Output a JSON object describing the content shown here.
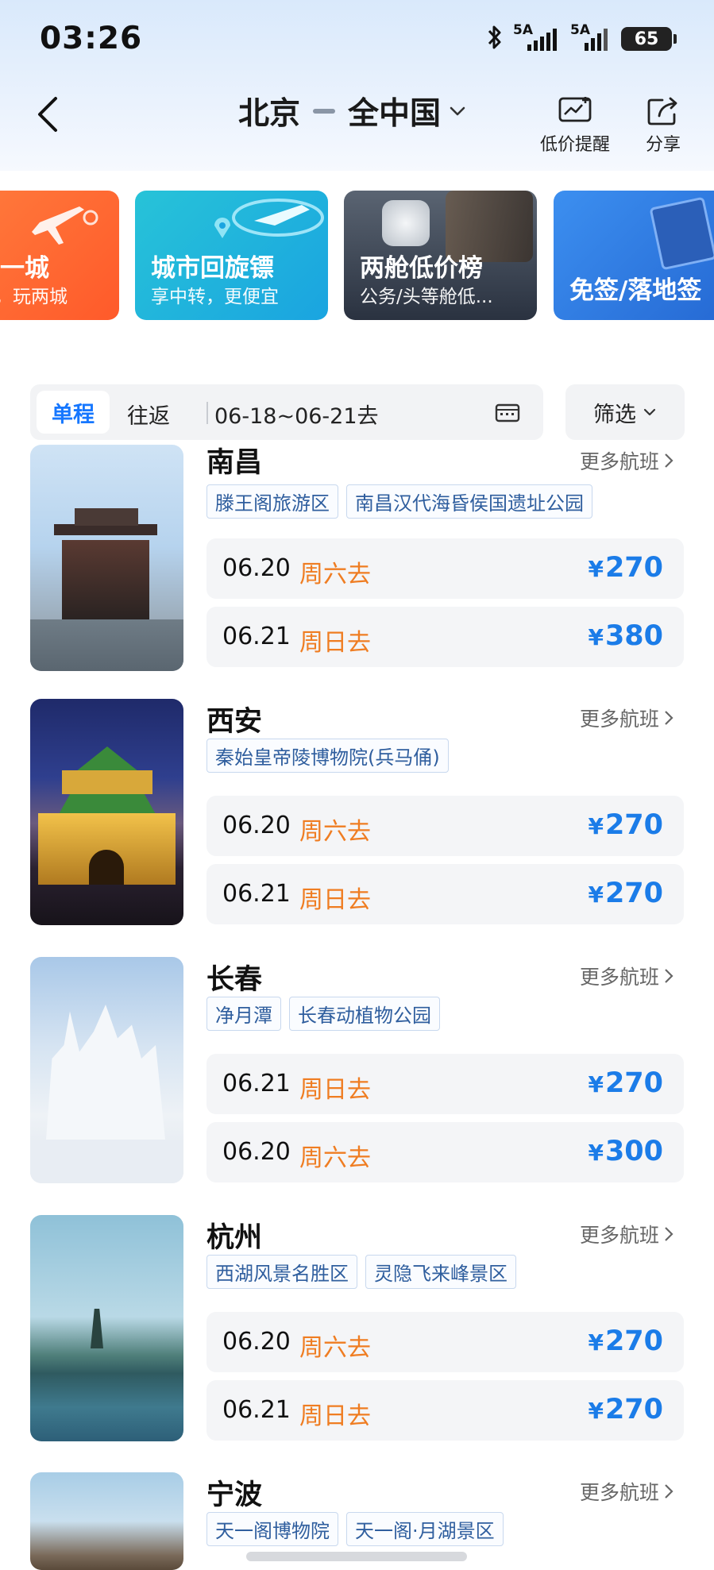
{
  "status_bar": {
    "time": "03:26",
    "signal1_label": "5A",
    "signal2_label": "5A",
    "battery": "65"
  },
  "header": {
    "origin": "北京",
    "destination": "全中国",
    "price_alert_label": "低价提醒",
    "share_label": "分享"
  },
  "banners": [
    {
      "title": "一城",
      "subtitle": "景，玩两城"
    },
    {
      "title": "城市回旋镖",
      "subtitle": "享中转，更便宜"
    },
    {
      "title": "两舱低价榜",
      "subtitle": "公务/头等舱低..."
    },
    {
      "title": "免签/落地签",
      "subtitle": ""
    }
  ],
  "filter": {
    "tab_oneway": "单程",
    "tab_roundtrip": "往返",
    "date_range": "06-18~06-21去",
    "filter_label": "筛选"
  },
  "more_flights_label": "更多航班",
  "currency": "¥",
  "destinations": [
    {
      "city": "南昌",
      "tags": [
        "滕王阁旅游区",
        "南昌汉代海昏侯国遗址公园"
      ],
      "flights": [
        {
          "date": "06.20",
          "weekday": "周六去",
          "price": "270"
        },
        {
          "date": "06.21",
          "weekday": "周日去",
          "price": "380"
        }
      ]
    },
    {
      "city": "西安",
      "tags": [
        "秦始皇帝陵博物院(兵马俑)"
      ],
      "flights": [
        {
          "date": "06.20",
          "weekday": "周六去",
          "price": "270"
        },
        {
          "date": "06.21",
          "weekday": "周日去",
          "price": "270"
        }
      ]
    },
    {
      "city": "长春",
      "tags": [
        "净月潭",
        "长春动植物公园"
      ],
      "flights": [
        {
          "date": "06.21",
          "weekday": "周日去",
          "price": "270"
        },
        {
          "date": "06.20",
          "weekday": "周六去",
          "price": "300"
        }
      ]
    },
    {
      "city": "杭州",
      "tags": [
        "西湖风景名胜区",
        "灵隐飞来峰景区"
      ],
      "flights": [
        {
          "date": "06.20",
          "weekday": "周六去",
          "price": "270"
        },
        {
          "date": "06.21",
          "weekday": "周日去",
          "price": "270"
        }
      ]
    },
    {
      "city": "宁波",
      "tags": [
        "天一阁博物院",
        "天一阁·月湖景区"
      ],
      "flights": []
    }
  ]
}
